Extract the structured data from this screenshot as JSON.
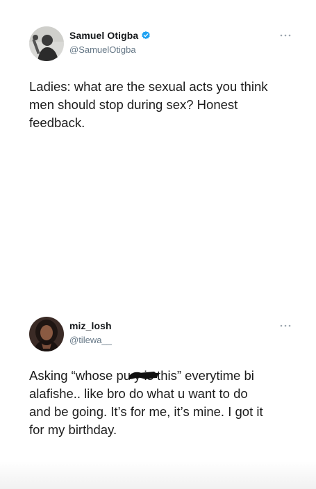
{
  "tweets": [
    {
      "display_name": "Samuel Otigba",
      "handle": "@SamuelOtigba",
      "verified": true,
      "avatar_icon": "person-with-microphone-avatar",
      "text": "Ladies: what are the sexual acts you think\nmen should stop during sex? Honest\nfeedback."
    },
    {
      "display_name": "miz_losh",
      "handle": "@tilewa__",
      "verified": false,
      "avatar_icon": "woman-portrait-avatar",
      "text": "Asking “whose pu    y is this” everytime bi\nalafishe.. like bro do what u want to do\nand be going. It’s for me, it’s mine. I got it\nfor my birthday."
    }
  ],
  "colors": {
    "verified_badge": "#1da1f2",
    "handle_gray": "#657786",
    "text": "#1c1c1c"
  },
  "icons": {
    "verified": "verified-badge-icon",
    "more": "more-options-icon"
  }
}
